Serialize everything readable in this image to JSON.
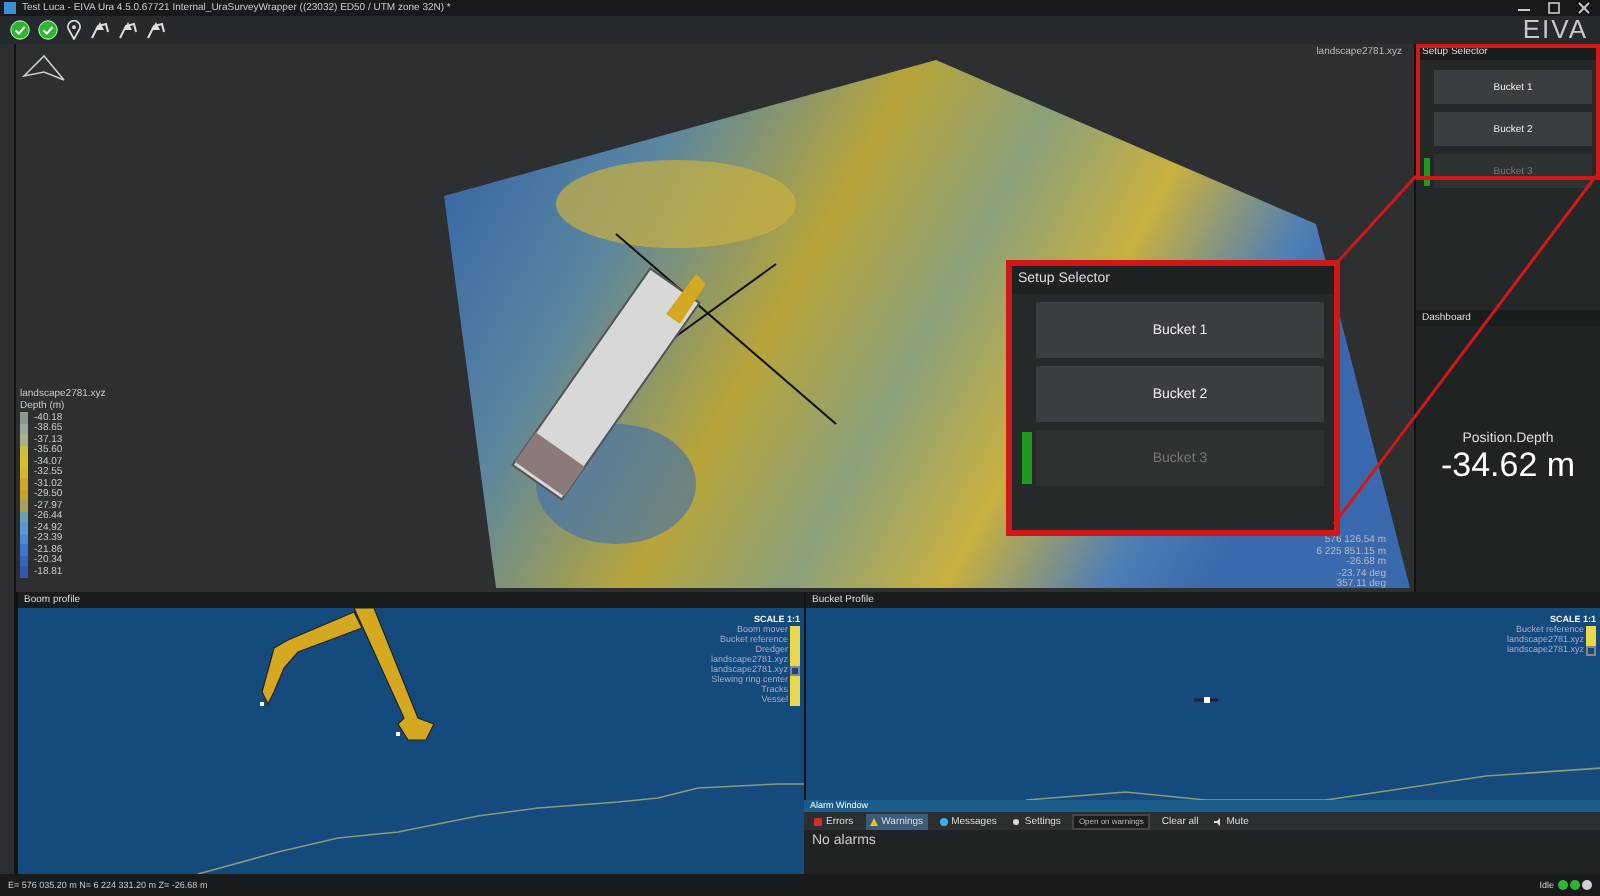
{
  "window": {
    "title": "Test Luca - EIVA Ura 4.5.0.67721 Internal_UraSurveyWrapper ((23032) ED50 / UTM zone 32N) *",
    "logo": "EIVA"
  },
  "toolbar": [
    {
      "kind": "ok"
    },
    {
      "kind": "ok"
    },
    {
      "kind": "pin"
    },
    {
      "kind": "crane"
    },
    {
      "kind": "crane"
    },
    {
      "kind": "crane"
    }
  ],
  "viewport": {
    "source": "landscape2781.xyz",
    "legend": {
      "title": "landscape2781.xyz",
      "unit": "Depth (m)",
      "values": [
        "-40.18",
        "-38.65",
        "-37.13",
        "-35.60",
        "-34.07",
        "-32.55",
        "-31.02",
        "-29.50",
        "-27.97",
        "-26.44",
        "-24.92",
        "-23.39",
        "-21.86",
        "-20.34",
        "-18.81"
      ]
    },
    "readout": [
      "576 126.54 m",
      "6 225 851.15 m",
      "-26.68 m",
      "-23.74 deg",
      "357.11 deg"
    ]
  },
  "setup_selector": {
    "title": "Setup Selector",
    "buckets": [
      {
        "label": "Bucket 1",
        "disabled": false,
        "active": false
      },
      {
        "label": "Bucket 2",
        "disabled": false,
        "active": false
      },
      {
        "label": "Bucket 3",
        "disabled": true,
        "active": true
      }
    ]
  },
  "callout": {
    "title": "Setup Selector",
    "buckets": [
      {
        "label": "Bucket 1",
        "disabled": false,
        "active": false
      },
      {
        "label": "Bucket 2",
        "disabled": false,
        "active": false
      },
      {
        "label": "Bucket 3",
        "disabled": true,
        "active": true
      }
    ]
  },
  "dashboard": {
    "title": "Dashboard",
    "label": "Position.Depth",
    "value": "-34.62 m"
  },
  "boom_profile": {
    "title": "Boom profile",
    "scale": "SCALE 1:1",
    "layers": [
      {
        "label": "Boom mover",
        "checked": true
      },
      {
        "label": "Bucket reference",
        "checked": true
      },
      {
        "label": "Dredger",
        "checked": true
      },
      {
        "label": "landscape2781.xyz",
        "checked": true
      },
      {
        "label": "landscape2781.xyz",
        "checked": false
      },
      {
        "label": "Slewing ring center",
        "checked": true
      },
      {
        "label": "Tracks",
        "checked": true
      },
      {
        "label": "Vessel",
        "checked": true
      }
    ]
  },
  "bucket_profile": {
    "title": "Bucket Profile",
    "scale": "SCALE 1:1",
    "layers": [
      {
        "label": "Bucket reference",
        "checked": true
      },
      {
        "label": "landscape2781.xyz",
        "checked": true
      },
      {
        "label": "landscape2781.xyz",
        "checked": false
      }
    ]
  },
  "alarm_window": {
    "title": "Alarm Window",
    "filters": [
      {
        "kind": "errors",
        "label": "Errors",
        "selected": false
      },
      {
        "kind": "warnings",
        "label": "Warnings",
        "selected": true
      },
      {
        "kind": "messages",
        "label": "Messages",
        "selected": false
      }
    ],
    "settings": "Settings",
    "dropdown": "Open on warnings",
    "clear": "Clear all",
    "mute": "Mute",
    "message": "No alarms"
  },
  "status_bar": {
    "coordinates": "E= 576 035.20 m N= 6 224 331.20 m Z= -26.68 m",
    "state": "Idle",
    "lights": [
      {
        "color": "#2fb52f"
      },
      {
        "color": "#2fb52f"
      },
      {
        "color": "#d0d0d0"
      }
    ]
  }
}
